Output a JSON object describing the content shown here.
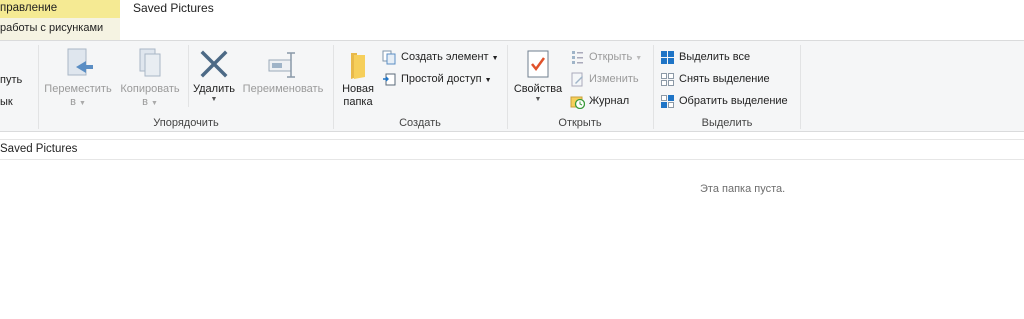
{
  "tabs": {
    "context_tab_label": "правление",
    "context_tab_sub": "работы с рисунками",
    "window_title": "Saved Pictures"
  },
  "ribbon": {
    "clipboard_partial": {
      "line1": "путь",
      "line2": "ык"
    },
    "organize": {
      "label": "Упорядочить",
      "move_to": "Переместить",
      "move_to_sub": "в",
      "copy_to": "Копировать",
      "copy_to_sub": "в",
      "delete": "Удалить",
      "rename": "Переименовать"
    },
    "create": {
      "label": "Создать",
      "new_folder_line1": "Новая",
      "new_folder_line2": "папка",
      "new_item": "Создать элемент",
      "easy_access": "Простой доступ"
    },
    "open": {
      "label": "Открыть",
      "properties": "Свойства",
      "open": "Открыть",
      "edit": "Изменить",
      "history": "Журнал"
    },
    "select": {
      "label": "Выделить",
      "select_all": "Выделить все",
      "select_none": "Снять выделение",
      "invert": "Обратить выделение"
    }
  },
  "address": {
    "path": "Saved Pictures"
  },
  "content": {
    "empty_message": "Эта папка пуста."
  },
  "colors": {
    "context_tab": "#f5ea93",
    "ribbon_bg": "#f5f6f7",
    "accent_blue": "#1e74c6"
  }
}
